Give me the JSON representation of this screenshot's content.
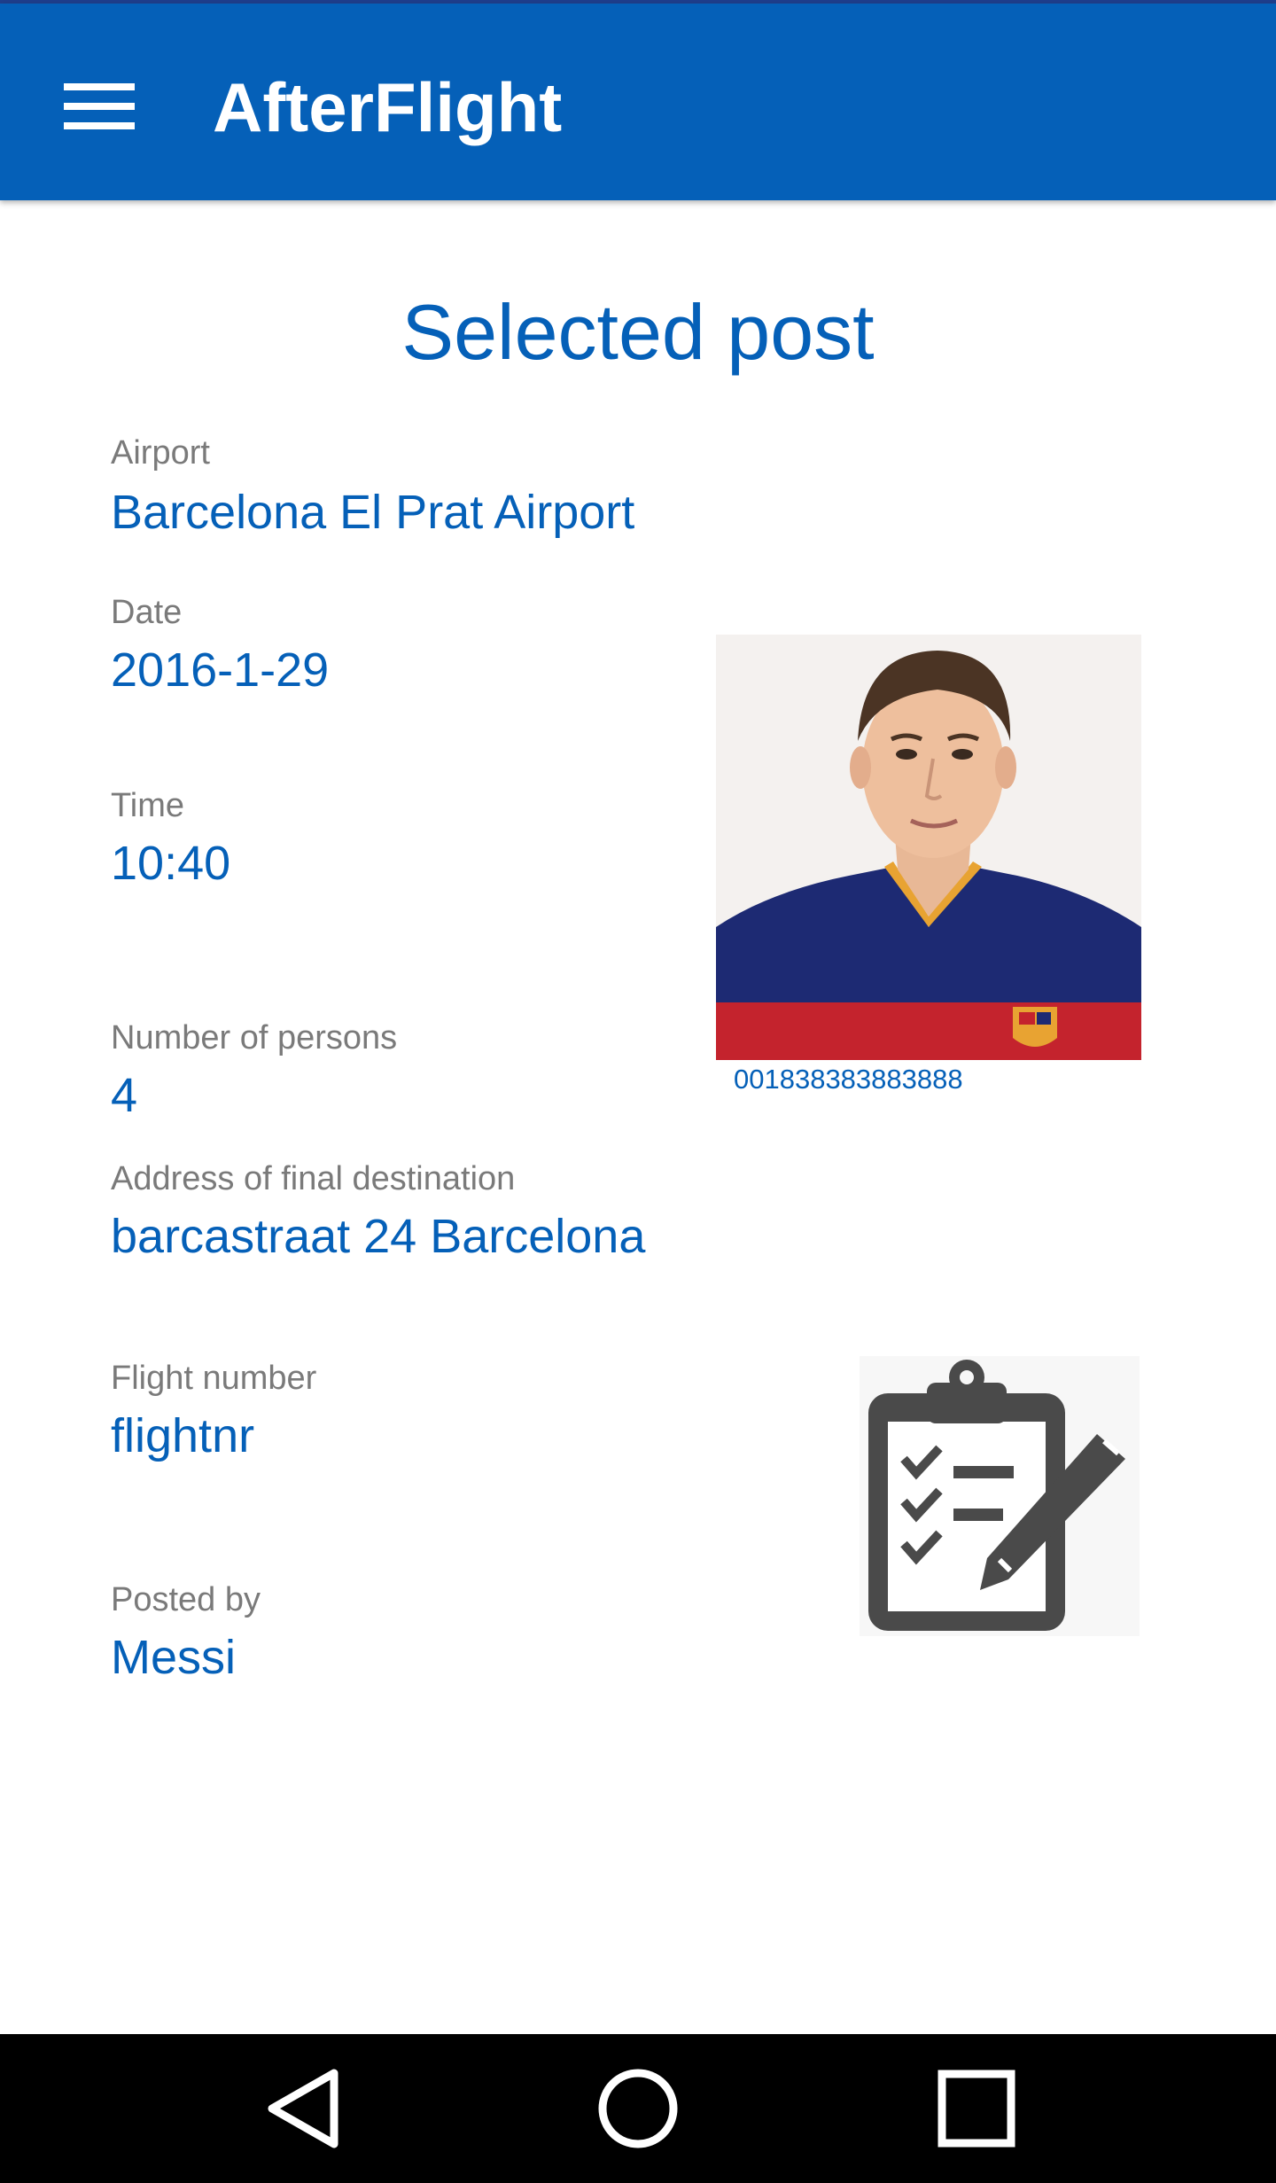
{
  "app": {
    "title": "AfterFlight",
    "accent_color": "#0560b8"
  },
  "icons": {
    "menu": "menu-icon",
    "clipboard": "clipboard-edit-icon",
    "back": "back-icon",
    "home": "home-icon",
    "recents": "recents-icon"
  },
  "page": {
    "title": "Selected post"
  },
  "post": {
    "airport_label": "Airport",
    "airport": "Barcelona El Prat Airport",
    "date_label": "Date",
    "date": "2016-1-29",
    "time_label": "Time",
    "time": "10:40",
    "persons_label": "Number of persons",
    "persons": "4",
    "address_label": "Address of final destination",
    "address": "barcastraat 24 Barcelona",
    "flight_label": "Flight number",
    "flight": "flightnr",
    "posted_by_label": "Posted by",
    "posted_by": "Messi"
  },
  "profile": {
    "phone": "001838383883888"
  }
}
